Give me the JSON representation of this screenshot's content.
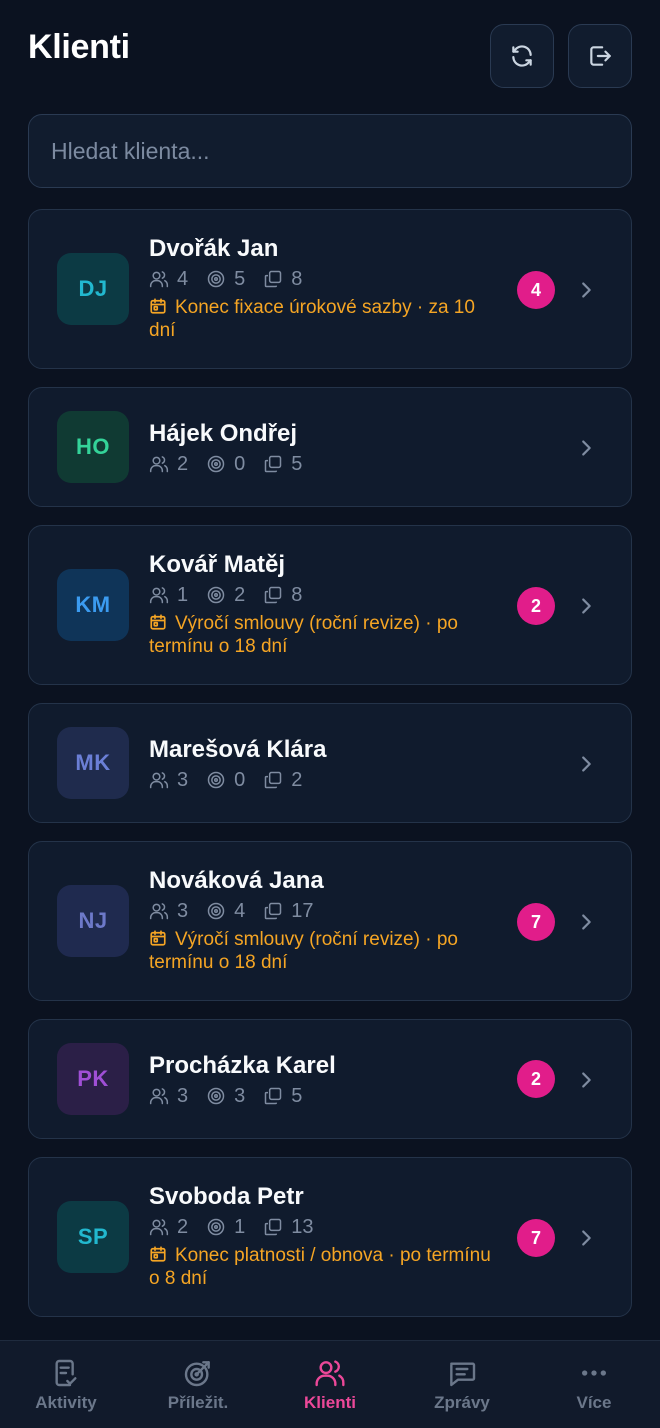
{
  "header": {
    "title": "Klienti"
  },
  "search": {
    "placeholder": "Hledat klienta..."
  },
  "clients": [
    {
      "initials": "DJ",
      "name": "Dvořák Jan",
      "contacts": "4",
      "targets": "5",
      "docs": "8",
      "alert": "Konec fixace úrokové sazby · za 10 dní",
      "badge": "4",
      "avatar_bg": "#0c3a44",
      "avatar_fg": "#22b8cf"
    },
    {
      "initials": "HO",
      "name": "Hájek Ondřej",
      "contacts": "2",
      "targets": "0",
      "docs": "5",
      "alert": "",
      "badge": "",
      "avatar_bg": "#103a33",
      "avatar_fg": "#34d399"
    },
    {
      "initials": "KM",
      "name": "Kovář Matěj",
      "contacts": "1",
      "targets": "2",
      "docs": "8",
      "alert": "Výročí smlouvy (roční revize) · po termínu o 18 dní",
      "badge": "2",
      "avatar_bg": "#0f3458",
      "avatar_fg": "#3b9bf0"
    },
    {
      "initials": "MK",
      "name": "Marešová Klára",
      "contacts": "3",
      "targets": "0",
      "docs": "2",
      "alert": "",
      "badge": "",
      "avatar_bg": "#1f2b4d",
      "avatar_fg": "#6b7fd6"
    },
    {
      "initials": "NJ",
      "name": "Nováková Jana",
      "contacts": "3",
      "targets": "4",
      "docs": "17",
      "alert": "Výročí smlouvy (roční revize) · po termínu o 18 dní",
      "badge": "7",
      "avatar_bg": "#1f2a4f",
      "avatar_fg": "#6d79c9"
    },
    {
      "initials": "PK",
      "name": "Procházka Karel",
      "contacts": "3",
      "targets": "3",
      "docs": "5",
      "alert": "",
      "badge": "2",
      "avatar_bg": "#2b1f47",
      "avatar_fg": "#a04fd6"
    },
    {
      "initials": "SP",
      "name": "Svoboda Petr",
      "contacts": "2",
      "targets": "1",
      "docs": "13",
      "alert": "Konec platnosti / obnova · po termínu o 8 dní",
      "badge": "7",
      "avatar_bg": "#0c3a44",
      "avatar_fg": "#22b8cf"
    }
  ],
  "tabbar": {
    "tabs": [
      {
        "label": "Aktivity",
        "icon": "clipboard-check-icon"
      },
      {
        "label": "Příležit.",
        "icon": "target-arrow-icon"
      },
      {
        "label": "Klienti",
        "icon": "users-icon"
      },
      {
        "label": "Zprávy",
        "icon": "message-icon"
      },
      {
        "label": "Více",
        "icon": "more-icon"
      }
    ],
    "active": "Klienti"
  },
  "colors": {
    "accent": "#ec4899",
    "badge": "#e11d8a",
    "alert": "#f5a524",
    "background": "#0b1220",
    "card": "#101b2d"
  }
}
